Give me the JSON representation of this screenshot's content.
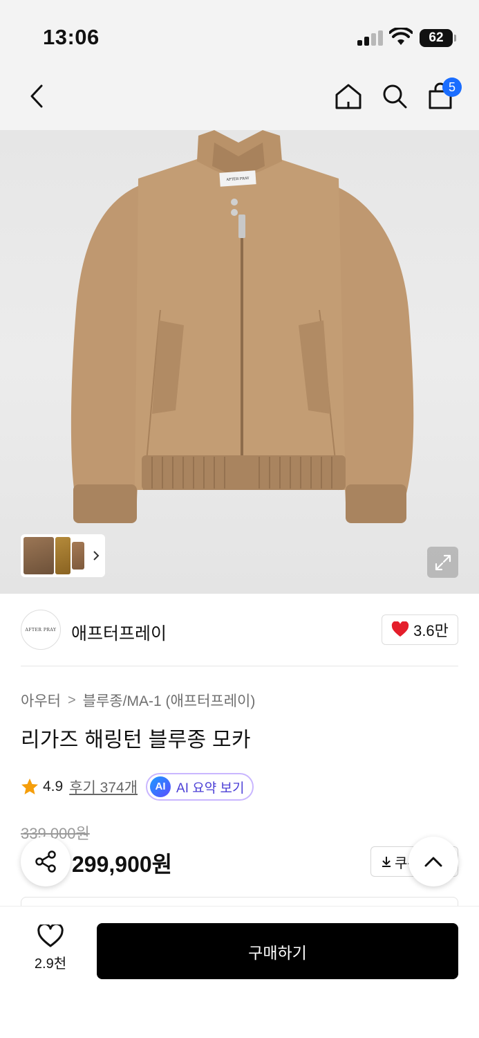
{
  "status_bar": {
    "time": "13:06",
    "battery": "62"
  },
  "header": {
    "cart_count": "5"
  },
  "brand": {
    "logo_text": "AFTER PRAY",
    "name": "애프터프레이",
    "likes": "3.6만"
  },
  "breadcrumb": {
    "category": "아우터",
    "subcategory": "블루종/MA-1 (애프터프레이)"
  },
  "product": {
    "title": "리가즈 해링턴 블루종 모카",
    "rating": "4.9",
    "reviews": "후기 374개",
    "ai_badge": "AI",
    "ai_summary": "AI 요약 보기",
    "original_price": "339,000원",
    "price": "299,900원",
    "coupon_label": "쿠폰받기",
    "jacket_label": "AFTER PRAY"
  },
  "bottom_bar": {
    "wish_count": "2.9천",
    "buy_label": "구매하기"
  },
  "colors": {
    "accent_blue": "#1a6dff",
    "heart_red": "#e41e2b",
    "star_orange": "#f59e0b",
    "ai_purple": "#4b3fd6",
    "buy_black": "#000000",
    "jacket_camel": "#c19a72"
  },
  "icons": [
    "back-icon",
    "home-icon",
    "search-icon",
    "cart-icon",
    "expand-icon",
    "heart-filled-icon",
    "star-icon",
    "share-icon",
    "download-icon",
    "chevron-up-icon",
    "heart-outline-icon",
    "chevron-right-icon"
  ]
}
